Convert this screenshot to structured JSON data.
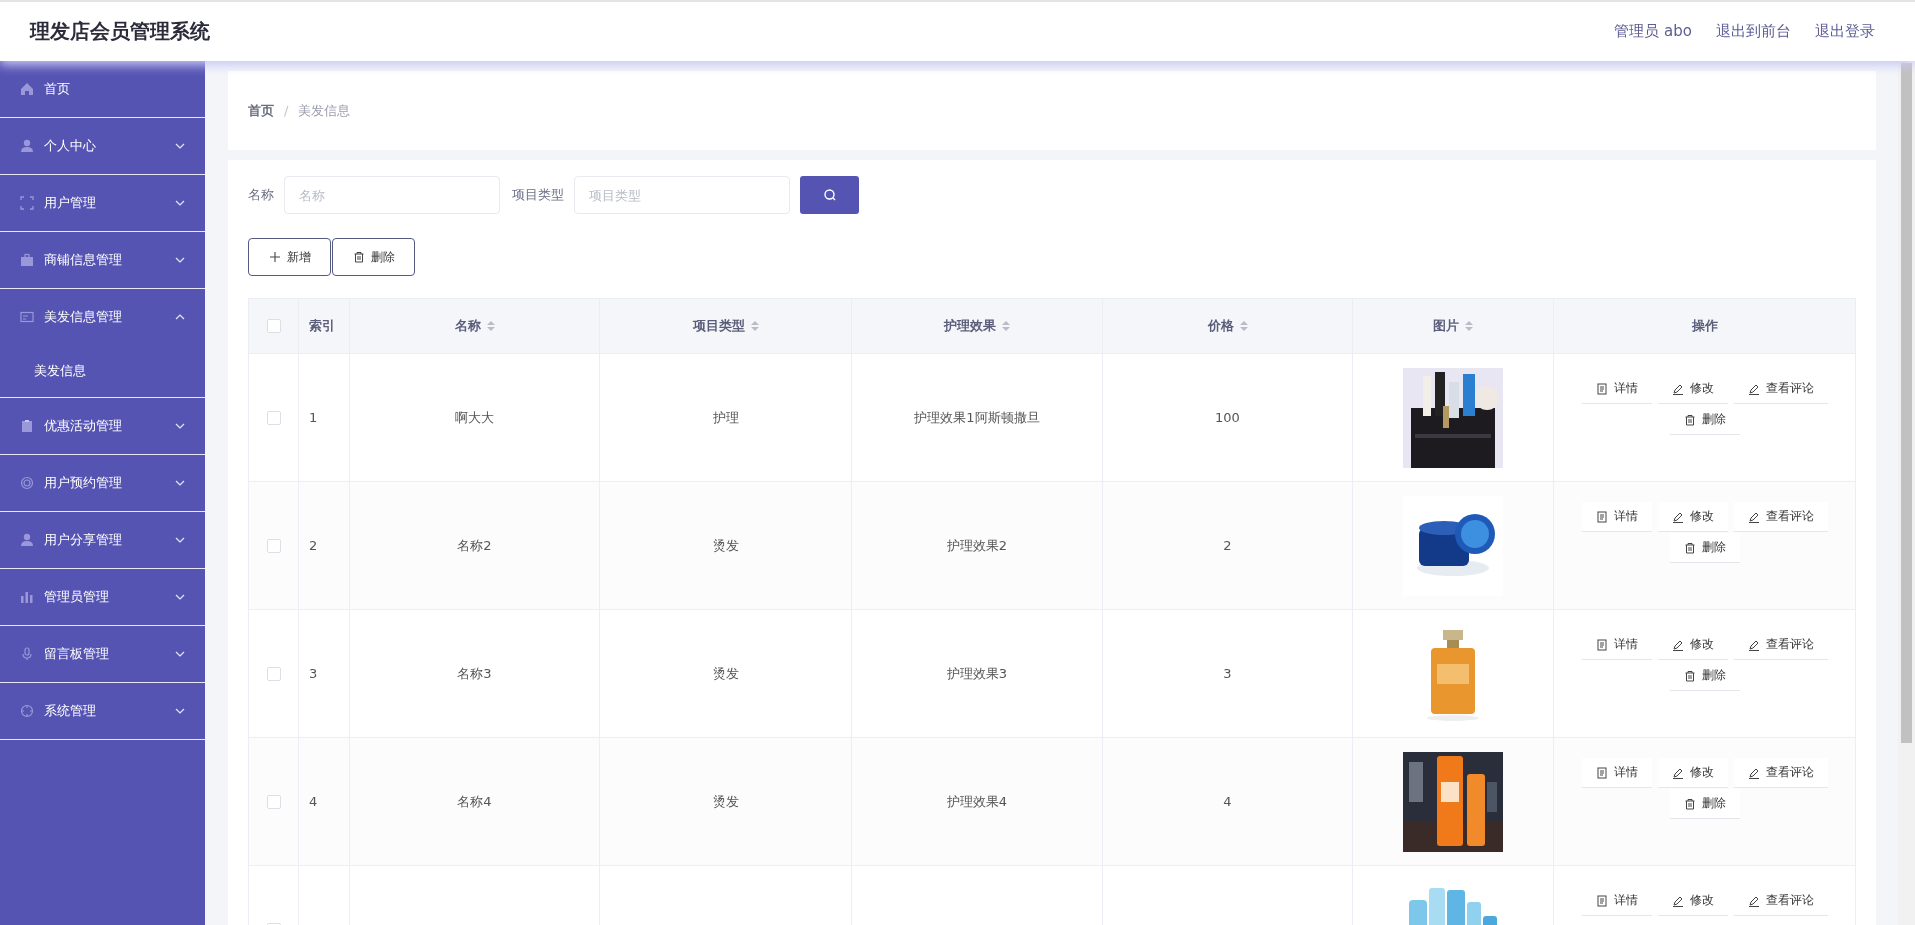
{
  "header": {
    "title": "理发店会员管理系统",
    "links": [
      "管理员 abo",
      "退出到前台",
      "退出登录"
    ]
  },
  "sidebar": {
    "items": [
      {
        "label": "首页"
      },
      {
        "label": "个人中心",
        "expanded": false
      },
      {
        "label": "用户管理",
        "expanded": false
      },
      {
        "label": "商铺信息管理",
        "expanded": false
      },
      {
        "label": "美发信息管理",
        "expanded": true,
        "children": [
          {
            "label": "美发信息"
          }
        ]
      },
      {
        "label": "优惠活动管理",
        "expanded": false
      },
      {
        "label": "用户预约管理",
        "expanded": false
      },
      {
        "label": "用户分享管理",
        "expanded": false
      },
      {
        "label": "管理员管理",
        "expanded": false
      },
      {
        "label": "留言板管理",
        "expanded": false
      },
      {
        "label": "系统管理",
        "expanded": false
      }
    ]
  },
  "breadcrumb": {
    "items": [
      "首页",
      "美发信息"
    ],
    "separator": "/"
  },
  "search": {
    "fields": [
      {
        "label": "名称",
        "placeholder": "名称"
      },
      {
        "label": "项目类型",
        "placeholder": "项目类型"
      }
    ]
  },
  "actions": [
    {
      "kind": "add",
      "label": "新增"
    },
    {
      "kind": "delete",
      "label": "删除"
    }
  ],
  "table": {
    "select_all": {
      "checked": false
    },
    "columns": [
      {
        "label": "索引",
        "sortable": false
      },
      {
        "label": "名称",
        "sortable": true
      },
      {
        "label": "项目类型",
        "sortable": true
      },
      {
        "label": "护理效果",
        "sortable": true
      },
      {
        "label": "价格",
        "sortable": true
      },
      {
        "label": "图片",
        "sortable": true
      },
      {
        "label": "操作",
        "sortable": false
      }
    ],
    "rows": [
      {
        "checked": false,
        "cells": [
          "1",
          "啊大大",
          "护理",
          "护理效果1阿斯顿撒旦",
          "100"
        ],
        "operations": [
          {
            "kind": "detail",
            "label": "详情"
          },
          {
            "kind": "edit",
            "label": "修改"
          },
          {
            "kind": "comment",
            "label": "查看评论"
          },
          {
            "kind": "delete",
            "label": "删除"
          }
        ]
      },
      {
        "checked": false,
        "cells": [
          "2",
          "名称2",
          "烫发",
          "护理效果2",
          "2"
        ],
        "operations": [
          {
            "kind": "detail",
            "label": "详情"
          },
          {
            "kind": "edit",
            "label": "修改"
          },
          {
            "kind": "comment",
            "label": "查看评论"
          },
          {
            "kind": "delete",
            "label": "删除"
          }
        ]
      },
      {
        "checked": false,
        "cells": [
          "3",
          "名称3",
          "烫发",
          "护理效果3",
          "3"
        ],
        "operations": [
          {
            "kind": "detail",
            "label": "详情"
          },
          {
            "kind": "edit",
            "label": "修改"
          },
          {
            "kind": "comment",
            "label": "查看评论"
          },
          {
            "kind": "delete",
            "label": "删除"
          }
        ]
      },
      {
        "checked": false,
        "cells": [
          "4",
          "名称4",
          "烫发",
          "护理效果4",
          "4"
        ],
        "operations": [
          {
            "kind": "detail",
            "label": "详情"
          },
          {
            "kind": "edit",
            "label": "修改"
          },
          {
            "kind": "comment",
            "label": "查看评论"
          },
          {
            "kind": "delete",
            "label": "删除"
          }
        ]
      },
      {
        "checked": false,
        "cells": [],
        "operations": [
          {
            "kind": "detail",
            "label": "详情"
          },
          {
            "kind": "edit",
            "label": "修改"
          },
          {
            "kind": "comment",
            "label": "查看评论"
          }
        ]
      }
    ]
  }
}
